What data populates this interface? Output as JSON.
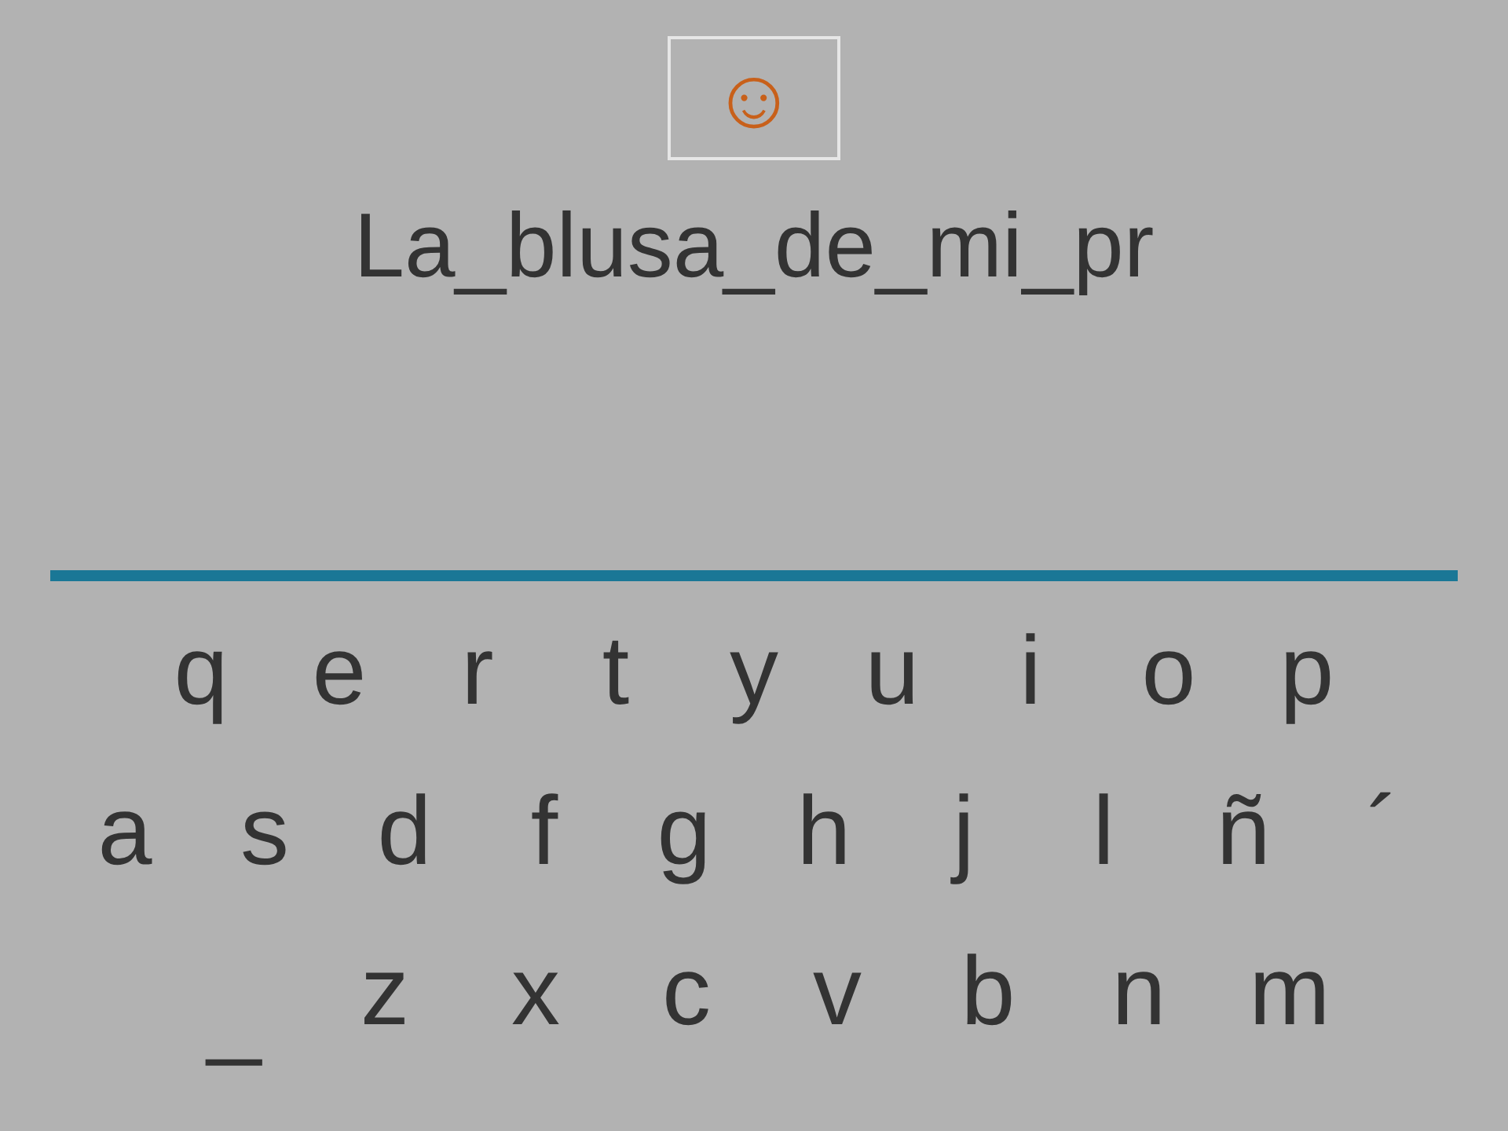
{
  "hint_box": {
    "symbol": "☺"
  },
  "sentence": "La_blusa_de_mi_pr",
  "keyboard": {
    "rows": [
      [
        "q",
        "e",
        "r",
        "t",
        "y",
        "u",
        "i",
        "o",
        "p"
      ],
      [
        "a",
        "s",
        "d",
        "f",
        "g",
        "h",
        "j",
        "l",
        "ñ",
        "´"
      ],
      [
        "_",
        "z",
        "x",
        "c",
        "v",
        "b",
        "n",
        "m"
      ]
    ]
  }
}
